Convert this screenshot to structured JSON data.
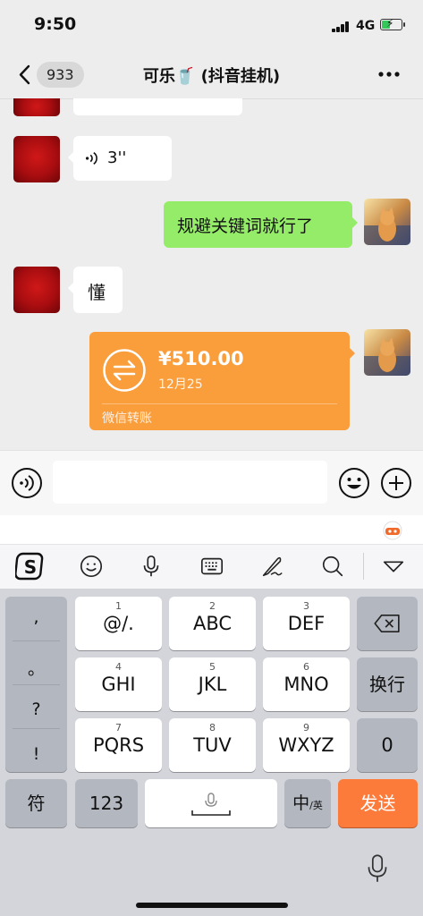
{
  "status_bar": {
    "time": "9:50",
    "network": "4G"
  },
  "nav": {
    "unread_count": "933",
    "title": "可乐🥤 (抖音挂机)",
    "more_icon": "more-dots-icon"
  },
  "messages": [
    {
      "side": "left",
      "type": "voice",
      "duration": "3''"
    },
    {
      "side": "right",
      "type": "text",
      "text": "规避关键词就行了"
    },
    {
      "side": "left",
      "type": "text",
      "text": "懂"
    },
    {
      "side": "right",
      "type": "transfer",
      "amount": "¥510.00",
      "date": "12月25",
      "label": "微信转账"
    }
  ],
  "keyboard": {
    "punctuation": [
      ",",
      "。",
      "?",
      "!"
    ],
    "keys": [
      {
        "num": "1",
        "label": "@/."
      },
      {
        "num": "2",
        "label": "ABC"
      },
      {
        "num": "3",
        "label": "DEF"
      },
      {
        "num": "4",
        "label": "GHI"
      },
      {
        "num": "5",
        "label": "JKL"
      },
      {
        "num": "6",
        "label": "MNO"
      },
      {
        "num": "7",
        "label": "PQRS"
      },
      {
        "num": "8",
        "label": "TUV"
      },
      {
        "num": "9",
        "label": "WXYZ"
      }
    ],
    "return_key": "换行",
    "zero_key": "0",
    "symbol_key": "符",
    "numbers_key": "123",
    "lang_key_main": "中",
    "lang_key_sub": "/英",
    "send_key": "发送"
  },
  "colors": {
    "send": "#fd7b3a",
    "transfer": "#fa9d3b",
    "bubble_green": "#95ec69"
  }
}
